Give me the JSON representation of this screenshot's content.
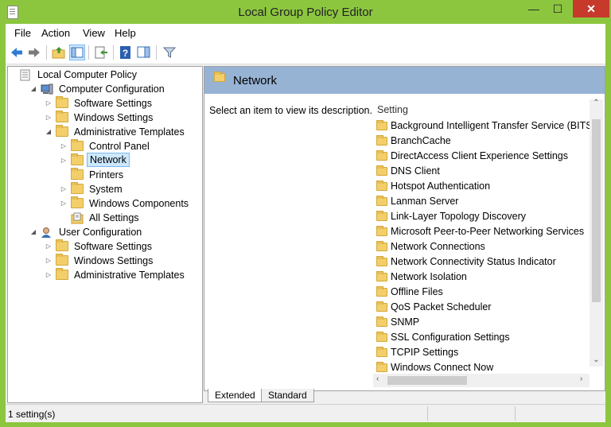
{
  "window": {
    "title": "Local Group Policy Editor",
    "min_glyph": "—",
    "max_glyph": "☐",
    "close_glyph": "✕"
  },
  "menu": [
    "File",
    "Action",
    "View",
    "Help"
  ],
  "toolbar_icons": [
    "back-arrow-icon",
    "forward-arrow-icon",
    "up-folder-icon",
    "show-hide-console-tree-icon",
    "export-list-icon",
    "help-icon",
    "show-hide-action-pane-icon",
    "filter-icon"
  ],
  "tree": [
    {
      "label": "Local Computer Policy",
      "level": 0,
      "expander": "",
      "icon": "policy-icon",
      "selected": false
    },
    {
      "label": "Computer Configuration",
      "level": 1,
      "expander": "◢",
      "icon": "computer-icon",
      "selected": false
    },
    {
      "label": "Software Settings",
      "level": 2,
      "expander": "▷",
      "icon": "folder-icon",
      "selected": false
    },
    {
      "label": "Windows Settings",
      "level": 2,
      "expander": "▷",
      "icon": "folder-icon",
      "selected": false
    },
    {
      "label": "Administrative Templates",
      "level": 2,
      "expander": "◢",
      "icon": "folder-icon",
      "selected": false
    },
    {
      "label": "Control Panel",
      "level": 3,
      "expander": "▷",
      "icon": "folder-icon",
      "selected": false
    },
    {
      "label": "Network",
      "level": 3,
      "expander": "▷",
      "icon": "folder-icon",
      "selected": true
    },
    {
      "label": "Printers",
      "level": 3,
      "expander": "",
      "icon": "folder-icon",
      "selected": false
    },
    {
      "label": "System",
      "level": 3,
      "expander": "▷",
      "icon": "folder-icon",
      "selected": false
    },
    {
      "label": "Windows Components",
      "level": 3,
      "expander": "▷",
      "icon": "folder-icon",
      "selected": false
    },
    {
      "label": "All Settings",
      "level": 3,
      "expander": "",
      "icon": "all-settings-icon",
      "selected": false
    },
    {
      "label": "User Configuration",
      "level": 1,
      "expander": "◢",
      "icon": "user-icon",
      "selected": false
    },
    {
      "label": "Software Settings",
      "level": 2,
      "expander": "▷",
      "icon": "folder-icon",
      "selected": false
    },
    {
      "label": "Windows Settings",
      "level": 2,
      "expander": "▷",
      "icon": "folder-icon",
      "selected": false
    },
    {
      "label": "Administrative Templates",
      "level": 2,
      "expander": "▷",
      "icon": "folder-icon",
      "selected": false
    }
  ],
  "details": {
    "header_title": "Network",
    "description": "Select an item to view its description.",
    "column_header": "Setting",
    "items": [
      "Background Intelligent Transfer Service (BITS)",
      "BranchCache",
      "DirectAccess Client Experience Settings",
      "DNS Client",
      "Hotspot Authentication",
      "Lanman Server",
      "Link-Layer Topology Discovery",
      "Microsoft Peer-to-Peer Networking Services",
      "Network Connections",
      "Network Connectivity Status Indicator",
      "Network Isolation",
      "Offline Files",
      "QoS Packet Scheduler",
      "SNMP",
      "SSL Configuration Settings",
      "TCPIP Settings",
      "Windows Connect Now"
    ]
  },
  "tabs": [
    {
      "label": "Extended",
      "active": true
    },
    {
      "label": "Standard",
      "active": false
    }
  ],
  "status": {
    "text": "1 setting(s)"
  }
}
